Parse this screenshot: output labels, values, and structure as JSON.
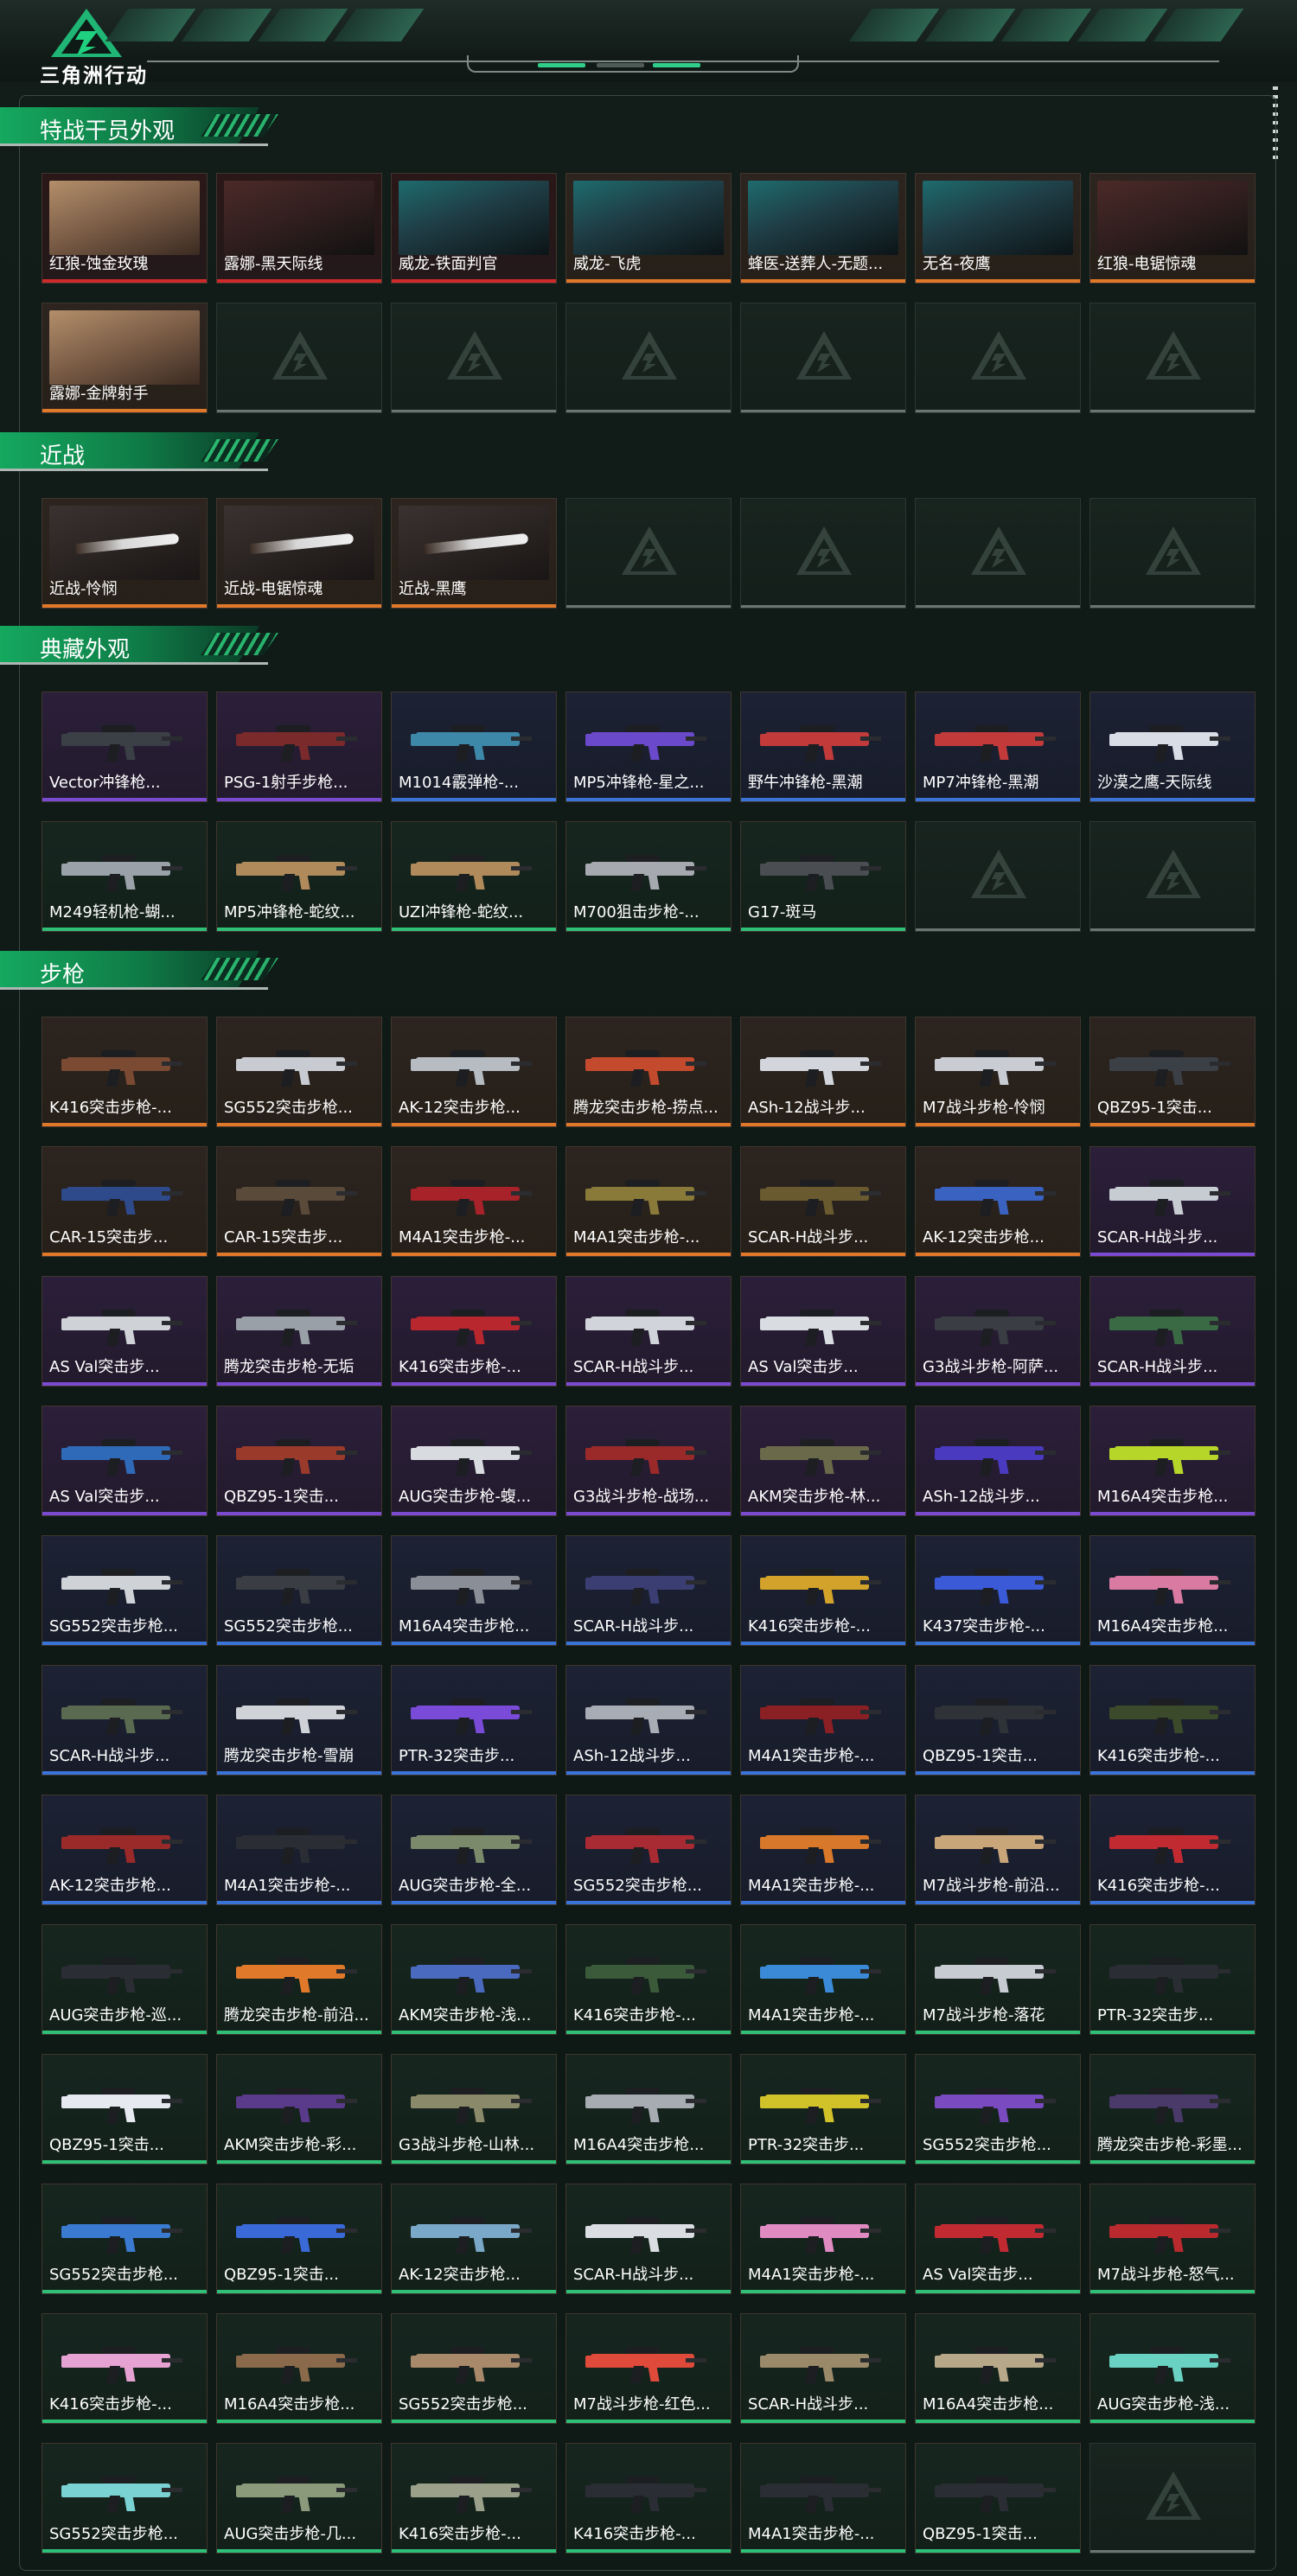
{
  "game_title": "三角洲行动",
  "sections": [
    {
      "title": "特战干员外观",
      "items": [
        {
          "label": "红狼-蚀金玫瑰",
          "rarity": "red",
          "kind": "op",
          "tone": "tan"
        },
        {
          "label": "露娜-黑天际线",
          "rarity": "red",
          "kind": "op",
          "tone": "dark"
        },
        {
          "label": "威龙-铁面判官",
          "rarity": "red",
          "kind": "op",
          "tone": "teal"
        },
        {
          "label": "威龙-飞虎",
          "rarity": "orange",
          "kind": "op",
          "tone": "teal"
        },
        {
          "label": "蜂医-送葬人-无题...",
          "rarity": "orange",
          "kind": "op",
          "tone": "teal"
        },
        {
          "label": "无名-夜鹰",
          "rarity": "orange",
          "kind": "op",
          "tone": "teal"
        },
        {
          "label": "红狼-电锯惊魂",
          "rarity": "orange",
          "kind": "op",
          "tone": "dark"
        },
        {
          "label": "露娜-金牌射手",
          "rarity": "orange",
          "kind": "op",
          "tone": "tan"
        },
        {
          "empty": true
        },
        {
          "empty": true
        },
        {
          "empty": true
        },
        {
          "empty": true
        },
        {
          "empty": true
        },
        {
          "empty": true
        }
      ]
    },
    {
      "title": "近战",
      "items": [
        {
          "label": "近战-怜悯",
          "rarity": "orange",
          "kind": "knife"
        },
        {
          "label": "近战-电锯惊魂",
          "rarity": "orange",
          "kind": "knife"
        },
        {
          "label": "近战-黑鹰",
          "rarity": "orange",
          "kind": "knife"
        },
        {
          "empty": true
        },
        {
          "empty": true
        },
        {
          "empty": true
        },
        {
          "empty": true
        }
      ]
    },
    {
      "title": "典藏外观",
      "items": [
        {
          "label": "Vector冲锋枪...",
          "rarity": "purple",
          "gun": "#3b3f46"
        },
        {
          "label": "PSG-1射手步枪...",
          "rarity": "purple",
          "gun": "#7a2a2a"
        },
        {
          "label": "M1014霰弹枪-...",
          "rarity": "blue",
          "gun": "#3d88a8"
        },
        {
          "label": "MP5冲锋枪-星之...",
          "rarity": "blue",
          "gun": "#6a4acb"
        },
        {
          "label": "野牛冲锋枪-黑潮",
          "rarity": "blue",
          "gun": "#c23a3a"
        },
        {
          "label": "MP7冲锋枪-黑潮",
          "rarity": "blue",
          "gun": "#c23a3a"
        },
        {
          "label": "沙漠之鹰-天际线",
          "rarity": "blue",
          "gun": "#d8dde6"
        },
        {
          "label": "M249轻机枪-蝴...",
          "rarity": "green",
          "gun": "#9aa1a8"
        },
        {
          "label": "MP5冲锋枪-蛇纹...",
          "rarity": "green",
          "gun": "#b08a5a"
        },
        {
          "label": "UZI冲锋枪-蛇纹...",
          "rarity": "green",
          "gun": "#b08a5a"
        },
        {
          "label": "M700狙击步枪-...",
          "rarity": "green",
          "gun": "#a7a9b0"
        },
        {
          "label": "G17-斑马",
          "rarity": "green",
          "gun": "#4a4d52"
        },
        {
          "empty": true
        },
        {
          "empty": true
        }
      ]
    },
    {
      "title": "步枪",
      "items": [
        {
          "label": "K416突击步枪-...",
          "rarity": "orange",
          "gun": "#7a4a32"
        },
        {
          "label": "SG552突击步枪...",
          "rarity": "orange",
          "gun": "#c8ccd2"
        },
        {
          "label": "AK-12突击步枪...",
          "rarity": "orange",
          "gun": "#b7bcc3"
        },
        {
          "label": "腾龙突击步枪-捞点...",
          "rarity": "orange",
          "gun": "#c44a2e"
        },
        {
          "label": "ASh-12战斗步...",
          "rarity": "orange",
          "gun": "#d2d6dc"
        },
        {
          "label": "M7战斗步枪-怜悯",
          "rarity": "orange",
          "gun": "#c9cdd3"
        },
        {
          "label": "QBZ95-1突击...",
          "rarity": "orange",
          "gun": "#3b3f46"
        },
        {
          "label": "CAR-15突击步...",
          "rarity": "orange",
          "gun": "#2e4a8a"
        },
        {
          "label": "CAR-15突击步...",
          "rarity": "orange",
          "gun": "#5a4a3a"
        },
        {
          "label": "M4A1突击步枪-...",
          "rarity": "orange",
          "gun": "#a8222a"
        },
        {
          "label": "M4A1突击步枪-...",
          "rarity": "orange",
          "gun": "#8a7a3a"
        },
        {
          "label": "SCAR-H战斗步...",
          "rarity": "orange",
          "gun": "#6a5a30"
        },
        {
          "label": "AK-12突击步枪...",
          "rarity": "orange",
          "gun": "#3a62c0"
        },
        {
          "label": "SCAR-H战斗步...",
          "rarity": "purple",
          "gun": "#c7cbd2"
        },
        {
          "label": "AS Val突击步...",
          "rarity": "purple",
          "gun": "#cfd3d8"
        },
        {
          "label": "腾龙突击步枪-无垢",
          "rarity": "purple",
          "gun": "#9aa0a8"
        },
        {
          "label": "K416突击步枪-...",
          "rarity": "purple",
          "gun": "#b8262e"
        },
        {
          "label": "SCAR-H战斗步...",
          "rarity": "purple",
          "gun": "#d1d5db"
        },
        {
          "label": "AS Val突击步...",
          "rarity": "purple",
          "gun": "#d9dde2"
        },
        {
          "label": "G3战斗步枪-阿萨...",
          "rarity": "purple",
          "gun": "#3a3d44"
        },
        {
          "label": "SCAR-H战斗步...",
          "rarity": "purple",
          "gun": "#3a6a44"
        },
        {
          "label": "AS Val突击步...",
          "rarity": "purple",
          "gun": "#2f6ab8"
        },
        {
          "label": "QBZ95-1突击...",
          "rarity": "purple",
          "gun": "#9a3a2a"
        },
        {
          "label": "AUG突击步枪-蝮...",
          "rarity": "purple",
          "gun": "#d8dce1"
        },
        {
          "label": "G3战斗步枪-战场...",
          "rarity": "purple",
          "gun": "#9a2a2a"
        },
        {
          "label": "AKM突击步枪-林...",
          "rarity": "purple",
          "gun": "#6a6a4a"
        },
        {
          "label": "ASh-12战斗步...",
          "rarity": "purple",
          "gun": "#4a3ac0"
        },
        {
          "label": "M16A4突击步枪...",
          "rarity": "purple",
          "gun": "#b7d62a"
        },
        {
          "label": "SG552突击步枪...",
          "rarity": "blue",
          "gun": "#cfd3d8"
        },
        {
          "label": "SG552突击步枪...",
          "rarity": "blue",
          "gun": "#3a3d44"
        },
        {
          "label": "M16A4突击步枪...",
          "rarity": "blue",
          "gun": "#8a8f97"
        },
        {
          "label": "SCAR-H战斗步...",
          "rarity": "blue",
          "gun": "#3a3e72"
        },
        {
          "label": "K416突击步枪-...",
          "rarity": "blue",
          "gun": "#d2a22a"
        },
        {
          "label": "K437突击步枪-...",
          "rarity": "blue",
          "gun": "#3a5ad8"
        },
        {
          "label": "M16A4突击步枪...",
          "rarity": "blue",
          "gun": "#d87aa2"
        },
        {
          "label": "SCAR-H战斗步...",
          "rarity": "blue",
          "gun": "#5a6a50"
        },
        {
          "label": "腾龙突击步枪-雪崩",
          "rarity": "blue",
          "gun": "#cfd3d8"
        },
        {
          "label": "PTR-32突击步...",
          "rarity": "blue",
          "gun": "#7a4ad8"
        },
        {
          "label": "ASh-12战斗步...",
          "rarity": "blue",
          "gun": "#a8adb5"
        },
        {
          "label": "M4A1突击步枪-...",
          "rarity": "blue",
          "gun": "#8a1f24"
        },
        {
          "label": "QBZ95-1突击...",
          "rarity": "blue",
          "gun": "#2f3236"
        },
        {
          "label": "K416突击步枪-...",
          "rarity": "blue",
          "gun": "#3a4a2a"
        },
        {
          "label": "AK-12突击步枪...",
          "rarity": "blue",
          "gun": "#9a2a2a"
        },
        {
          "label": "M4A1突击步枪-...",
          "rarity": "blue",
          "gun": "#2a2d33"
        },
        {
          "label": "AUG突击步枪-全...",
          "rarity": "blue",
          "gun": "#7a8a6a"
        },
        {
          "label": "SG552突击步枪...",
          "rarity": "blue",
          "gun": "#a82a32"
        },
        {
          "label": "M4A1突击步枪-...",
          "rarity": "blue",
          "gun": "#d8782a"
        },
        {
          "label": "M7战斗步枪-前沿...",
          "rarity": "blue",
          "gun": "#c9a67a"
        },
        {
          "label": "K416突击步枪-...",
          "rarity": "blue",
          "gun": "#c22a32"
        },
        {
          "label": "AUG突击步枪-巡...",
          "rarity": "green",
          "gun": "#2a2d33"
        },
        {
          "label": "腾龙突击步枪-前沿...",
          "rarity": "green",
          "gun": "#e07a2a"
        },
        {
          "label": "AKM突击步枪-浅...",
          "rarity": "green",
          "gun": "#4a6ac0"
        },
        {
          "label": "K416突击步枪-...",
          "rarity": "green",
          "gun": "#3a5a3a"
        },
        {
          "label": "M4A1突击步枪-...",
          "rarity": "green",
          "gun": "#3a8ad8"
        },
        {
          "label": "M7战斗步枪-落花",
          "rarity": "green",
          "gun": "#c7cbd2"
        },
        {
          "label": "PTR-32突击步...",
          "rarity": "green",
          "gun": "#2a2d33"
        },
        {
          "label": "QBZ95-1突击...",
          "rarity": "green",
          "gun": "#e6eaf0"
        },
        {
          "label": "AKM突击步枪-彩...",
          "rarity": "green",
          "gun": "#5a3a8a"
        },
        {
          "label": "G3战斗步枪-山林...",
          "rarity": "green",
          "gun": "#8a8a6a"
        },
        {
          "label": "M16A4突击步枪...",
          "rarity": "green",
          "gun": "#a7abb2"
        },
        {
          "label": "PTR-32突击步...",
          "rarity": "green",
          "gun": "#d2c22a"
        },
        {
          "label": "SG552突击步枪...",
          "rarity": "green",
          "gun": "#7a4ac0"
        },
        {
          "label": "腾龙突击步枪-彩墨...",
          "rarity": "green",
          "gun": "#4a3a6a"
        },
        {
          "label": "SG552突击步枪...",
          "rarity": "green",
          "gun": "#3a7ad0"
        },
        {
          "label": "QBZ95-1突击...",
          "rarity": "green",
          "gun": "#3a6ad8"
        },
        {
          "label": "AK-12突击步枪...",
          "rarity": "green",
          "gun": "#7aa8c8"
        },
        {
          "label": "SCAR-H战斗步...",
          "rarity": "green",
          "gun": "#dadde2"
        },
        {
          "label": "M4A1突击步枪-...",
          "rarity": "green",
          "gun": "#e08ac2"
        },
        {
          "label": "AS Val突击步...",
          "rarity": "green",
          "gun": "#c22a32"
        },
        {
          "label": "M7战斗步枪-怒气...",
          "rarity": "green",
          "gun": "#b82a2e"
        },
        {
          "label": "K416突击步枪-...",
          "rarity": "green",
          "gun": "#e6a2d2"
        },
        {
          "label": "M16A4突击步枪...",
          "rarity": "green",
          "gun": "#8a6a4a"
        },
        {
          "label": "SG552突击步枪...",
          "rarity": "green",
          "gun": "#a88a6a"
        },
        {
          "label": "M7战斗步枪-红色...",
          "rarity": "green",
          "gun": "#e04a3a"
        },
        {
          "label": "SCAR-H战斗步...",
          "rarity": "green",
          "gun": "#9a8a6a"
        },
        {
          "label": "M16A4突击步枪...",
          "rarity": "green",
          "gun": "#b8a88a"
        },
        {
          "label": "AUG突击步枪-浅...",
          "rarity": "green",
          "gun": "#6ad2c2"
        },
        {
          "label": "SG552突击步枪...",
          "rarity": "green",
          "gun": "#7ad2d2"
        },
        {
          "label": "AUG突击步枪-几...",
          "rarity": "green",
          "gun": "#8a9a7a"
        },
        {
          "label": "K416突击步枪-...",
          "rarity": "green",
          "gun": "#9aa08a"
        },
        {
          "label": "K416突击步枪-...",
          "rarity": "green",
          "gun": "#2a2d33"
        },
        {
          "label": "M4A1突击步枪-...",
          "rarity": "green",
          "gun": "#2a2d33"
        },
        {
          "label": "QBZ95-1突击...",
          "rarity": "green",
          "gun": "#2a2d33"
        },
        {
          "empty": true
        }
      ]
    }
  ]
}
